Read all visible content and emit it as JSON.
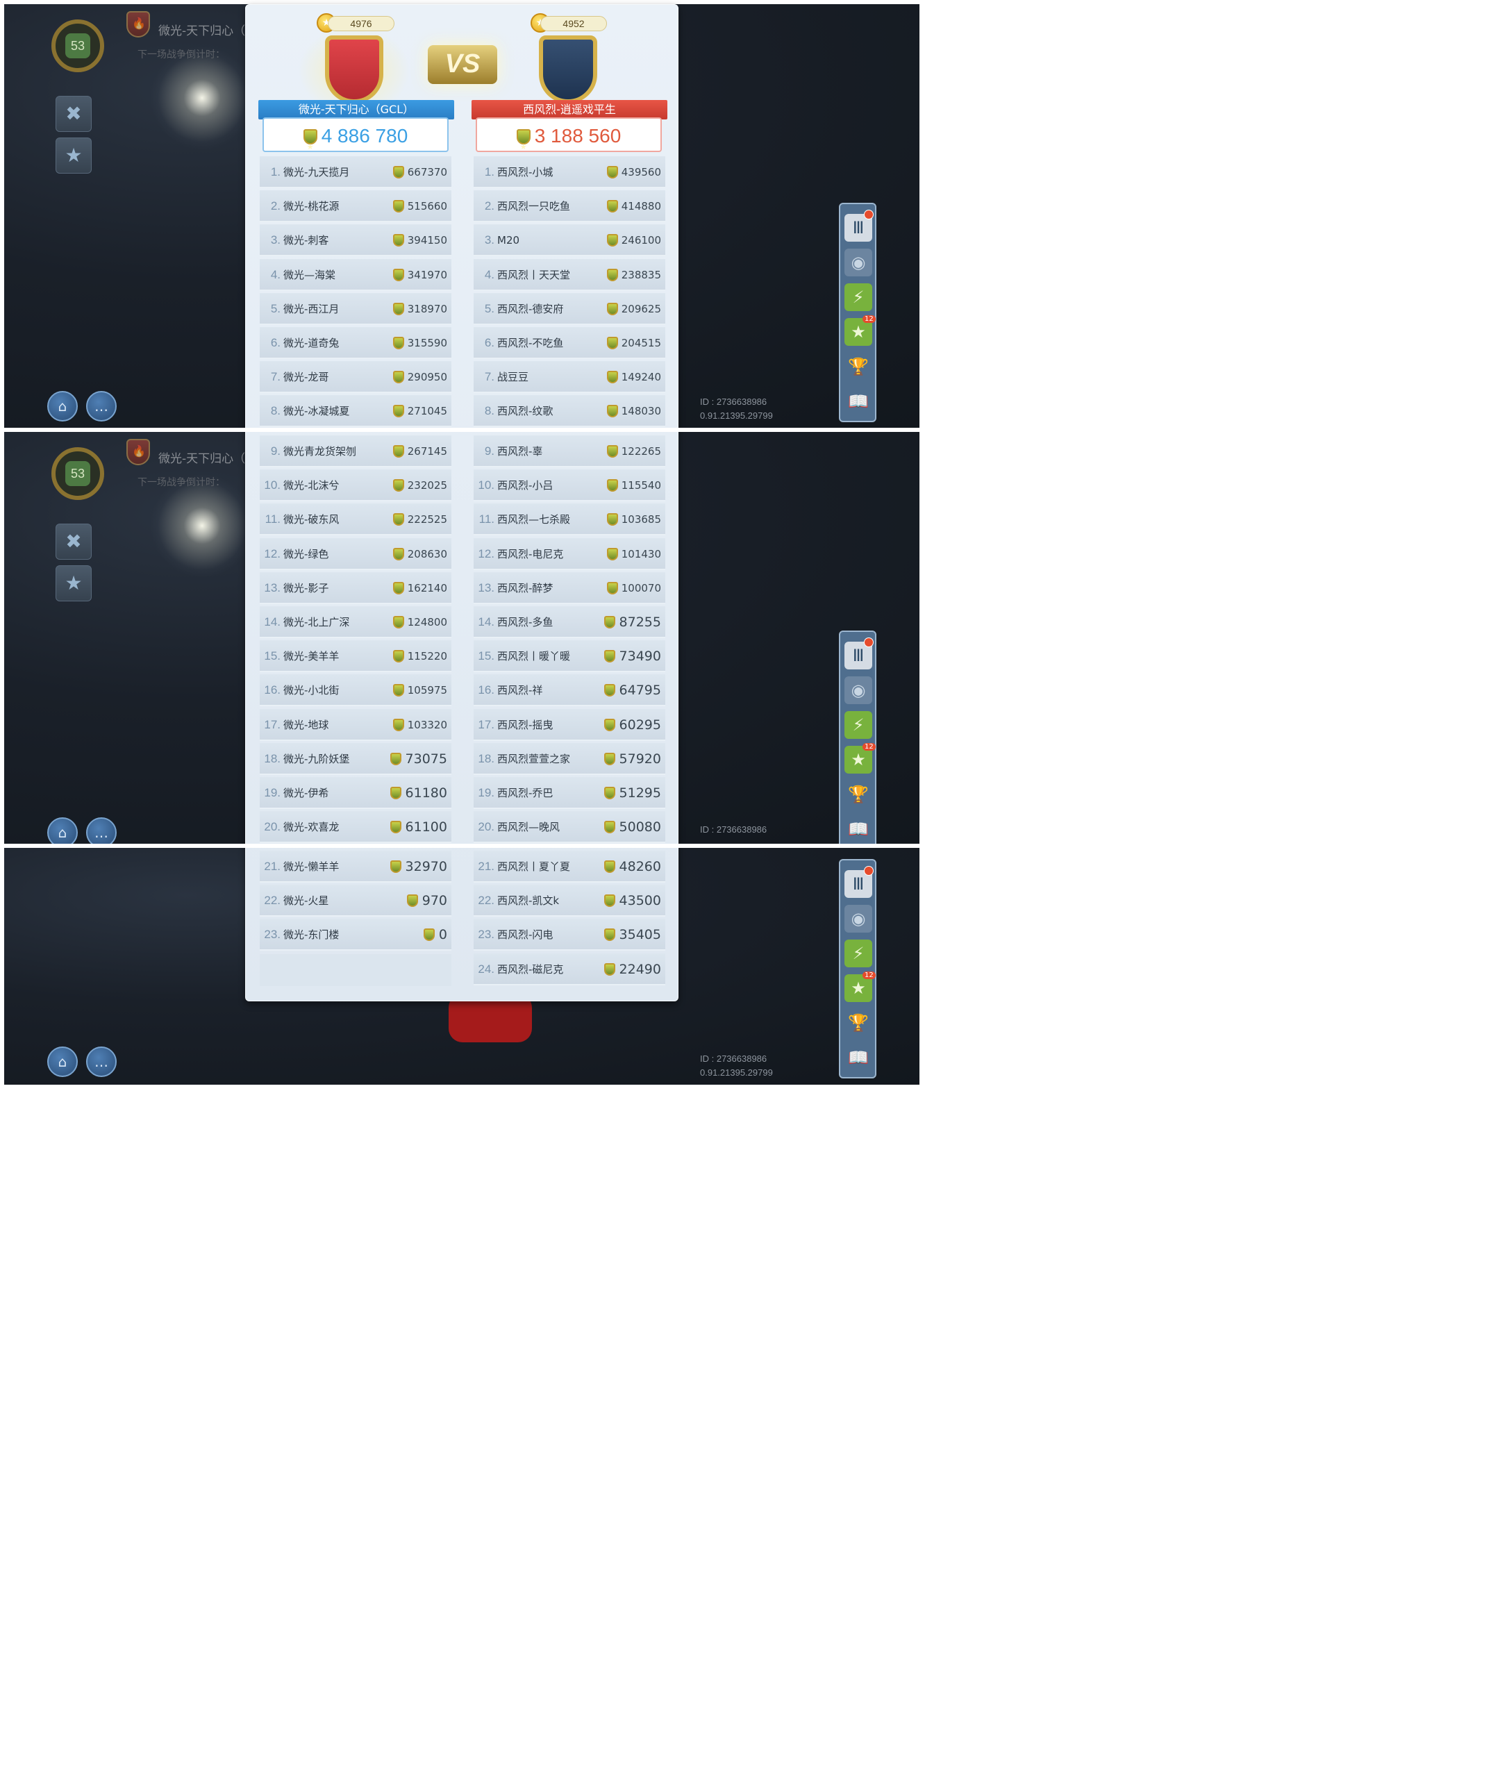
{
  "hud": {
    "level": "53",
    "alliance_name": "微光-天下归心（",
    "countdown": "下一场战争倒计时：",
    "user_id": "ID : 2736638986",
    "version": "0.91.21395.29799",
    "badge_count": "12"
  },
  "battle": {
    "vs_label": "VS",
    "left": {
      "trophies": "4976",
      "name": "微光-天下归心（GCL）",
      "total": "4 886 780",
      "members": [
        {
          "rank": "1.",
          "name": "微光-九天揽月",
          "score": "667370"
        },
        {
          "rank": "2.",
          "name": "微光-桃花源",
          "score": "515660"
        },
        {
          "rank": "3.",
          "name": "微光-刺客",
          "score": "394150"
        },
        {
          "rank": "4.",
          "name": "微光—海棠",
          "score": "341970"
        },
        {
          "rank": "5.",
          "name": "微光-西江月",
          "score": "318970"
        },
        {
          "rank": "6.",
          "name": "微光-道奇兔",
          "score": "315590"
        },
        {
          "rank": "7.",
          "name": "微光-龙哥",
          "score": "290950"
        },
        {
          "rank": "8.",
          "name": "微光-冰凝城夏",
          "score": "271045"
        },
        {
          "rank": "9.",
          "name": "微光青龙货架刎",
          "score": "267145"
        },
        {
          "rank": "10.",
          "name": "微光-北沫兮",
          "score": "232025"
        },
        {
          "rank": "11.",
          "name": "微光-破东风",
          "score": "222525"
        },
        {
          "rank": "12.",
          "name": "微光-绿色",
          "score": "208630"
        },
        {
          "rank": "13.",
          "name": "微光-影子",
          "score": "162140"
        },
        {
          "rank": "14.",
          "name": "微光-北上广深",
          "score": "124800"
        },
        {
          "rank": "15.",
          "name": "微光-美羊羊",
          "score": "115220"
        },
        {
          "rank": "16.",
          "name": "微光-小北街",
          "score": "105975"
        },
        {
          "rank": "17.",
          "name": "微光-地球",
          "score": "103320"
        },
        {
          "rank": "18.",
          "name": "微光-九阶妖堡",
          "score": "73075"
        },
        {
          "rank": "19.",
          "name": "微光-伊希",
          "score": "61180"
        },
        {
          "rank": "20.",
          "name": "微光-欢喜龙",
          "score": "61100"
        },
        {
          "rank": "21.",
          "name": "微光-懒羊羊",
          "score": "32970"
        },
        {
          "rank": "22.",
          "name": "微光-火星",
          "score": "970"
        },
        {
          "rank": "23.",
          "name": "微光-东门楼",
          "score": "0"
        }
      ]
    },
    "right": {
      "trophies": "4952",
      "name": "西风烈-逍遥戏平生",
      "total": "3 188 560",
      "members": [
        {
          "rank": "1.",
          "name": "西风烈-小城",
          "score": "439560"
        },
        {
          "rank": "2.",
          "name": "西风烈一只吃鱼",
          "score": "414880"
        },
        {
          "rank": "3.",
          "name": "M20",
          "score": "246100"
        },
        {
          "rank": "4.",
          "name": "西风烈丨天天堂",
          "score": "238835"
        },
        {
          "rank": "5.",
          "name": "西风烈-德安府",
          "score": "209625"
        },
        {
          "rank": "6.",
          "name": "西风烈-不吃鱼",
          "score": "204515"
        },
        {
          "rank": "7.",
          "name": "战豆豆",
          "score": "149240"
        },
        {
          "rank": "8.",
          "name": "西风烈-纹歌",
          "score": "148030"
        },
        {
          "rank": "9.",
          "name": "西风烈-辜",
          "score": "122265"
        },
        {
          "rank": "10.",
          "name": "西风烈-小吕",
          "score": "115540"
        },
        {
          "rank": "11.",
          "name": "西风烈—七杀殿",
          "score": "103685"
        },
        {
          "rank": "12.",
          "name": "西风烈-电尼克",
          "score": "101430"
        },
        {
          "rank": "13.",
          "name": "西风烈-醉梦",
          "score": "100070"
        },
        {
          "rank": "14.",
          "name": "西风烈-多鱼",
          "score": "87255"
        },
        {
          "rank": "15.",
          "name": "西风烈丨暖丫暖",
          "score": "73490"
        },
        {
          "rank": "16.",
          "name": "西风烈-祥",
          "score": "64795"
        },
        {
          "rank": "17.",
          "name": "西风烈-摇曳",
          "score": "60295"
        },
        {
          "rank": "18.",
          "name": "西风烈萱萱之家",
          "score": "57920"
        },
        {
          "rank": "19.",
          "name": "西风烈-乔巴",
          "score": "51295"
        },
        {
          "rank": "20.",
          "name": "西风烈—晚风",
          "score": "50080"
        },
        {
          "rank": "21.",
          "name": "西风烈丨夏丫夏",
          "score": "48260"
        },
        {
          "rank": "22.",
          "name": "西风烈-凯文k",
          "score": "43500"
        },
        {
          "rank": "23.",
          "name": "西风烈-闪电",
          "score": "35405"
        },
        {
          "rank": "24.",
          "name": "西风烈-磁尼克",
          "score": "22490"
        }
      ]
    }
  },
  "colors": {
    "blue_team": "#3ba0e4",
    "red_team": "#e05a3d",
    "panel": "#e3ebf3"
  },
  "icons": [
    "tools-icon",
    "shop-bag-icon",
    "home-icon",
    "chat-icon",
    "alliance-icon",
    "radar-icon",
    "energy-card-icon",
    "star-card-icon",
    "trophy-icon",
    "guide-book-icon"
  ]
}
